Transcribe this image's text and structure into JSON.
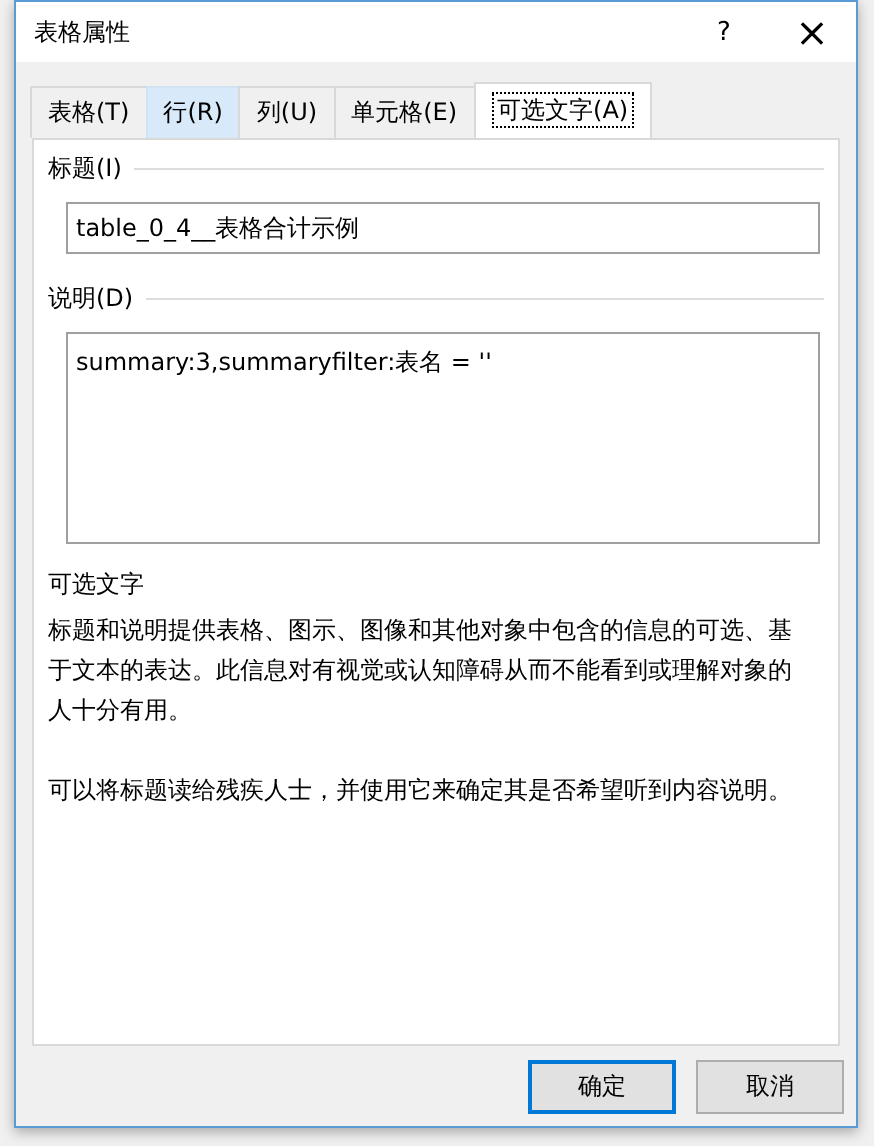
{
  "window": {
    "title": "表格属性",
    "help": "?",
    "close": "×"
  },
  "tabs": [
    {
      "label": "表格(T)",
      "selected": false,
      "hovered": false
    },
    {
      "label": "行(R)",
      "selected": false,
      "hovered": true
    },
    {
      "label": "列(U)",
      "selected": false,
      "hovered": false
    },
    {
      "label": "单元格(E)",
      "selected": false,
      "hovered": false
    },
    {
      "label": "可选文字(A)",
      "selected": true,
      "hovered": false
    }
  ],
  "title_group": {
    "label": "标题(I)",
    "value": "table_0_4__表格合计示例"
  },
  "description_group": {
    "label": "说明(D)",
    "value": "summary:3,summaryfilter:表名 = ''"
  },
  "help_section": {
    "heading": "可选文字",
    "paragraphs": [
      "标题和说明提供表格、图示、图像和其他对象中包含的信息的可选、基于文本的表达。此信息对有视觉或认知障碍从而不能看到或理解对象的人十分有用。",
      "可以将标题读给残疾人士，并使用它来确定其是否希望听到内容说明。"
    ]
  },
  "buttons": [
    {
      "label": "确定",
      "default": true
    },
    {
      "label": "取消",
      "default": false
    }
  ]
}
